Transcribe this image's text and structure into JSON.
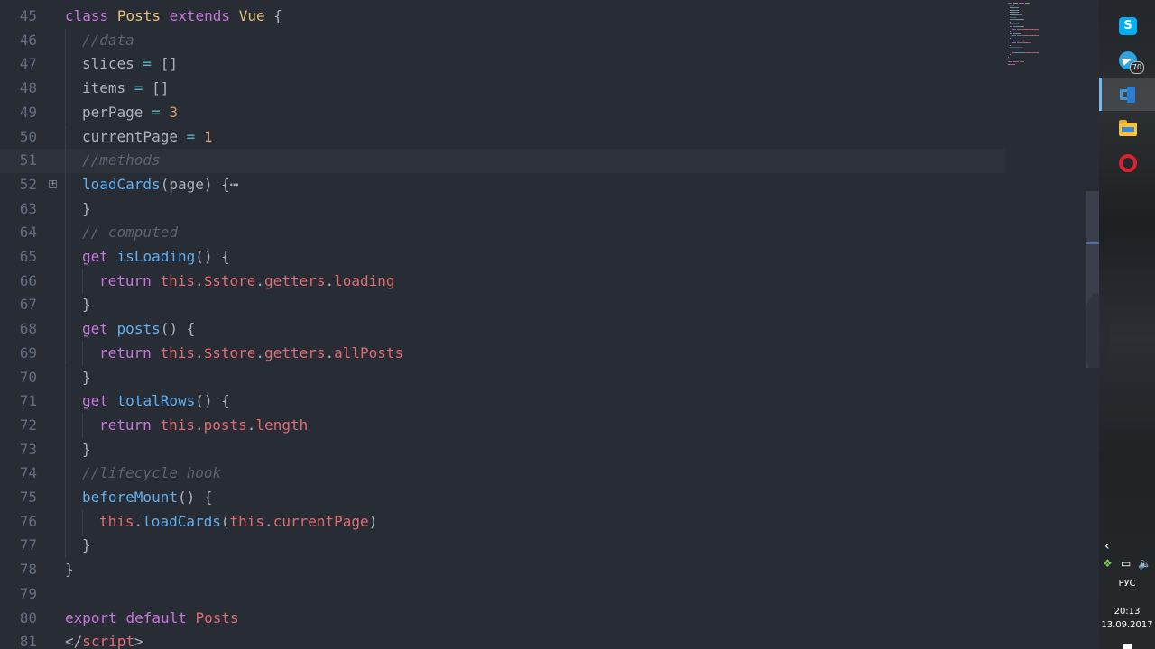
{
  "editor": {
    "current_line": "51",
    "lines": [
      {
        "num": "45",
        "indent": 0,
        "tokens": [
          {
            "t": "keyword",
            "v": "class"
          },
          {
            "t": "ident",
            "v": " "
          },
          {
            "t": "class",
            "v": "Posts"
          },
          {
            "t": "ident",
            "v": " "
          },
          {
            "t": "keyword",
            "v": "extends"
          },
          {
            "t": "ident",
            "v": " "
          },
          {
            "t": "class",
            "v": "Vue"
          },
          {
            "t": "punct",
            "v": " {"
          }
        ]
      },
      {
        "num": "46",
        "indent": 1,
        "tokens": [
          {
            "t": "comment",
            "v": "//data"
          }
        ]
      },
      {
        "num": "47",
        "indent": 1,
        "tokens": [
          {
            "t": "ident",
            "v": "slices"
          },
          {
            "t": "op",
            "v": " = "
          },
          {
            "t": "punct",
            "v": "[]"
          }
        ]
      },
      {
        "num": "48",
        "indent": 1,
        "tokens": [
          {
            "t": "ident",
            "v": "items"
          },
          {
            "t": "op",
            "v": " = "
          },
          {
            "t": "punct",
            "v": "[]"
          }
        ]
      },
      {
        "num": "49",
        "indent": 1,
        "tokens": [
          {
            "t": "ident",
            "v": "perPage"
          },
          {
            "t": "op",
            "v": " = "
          },
          {
            "t": "number",
            "v": "3"
          }
        ]
      },
      {
        "num": "50",
        "indent": 1,
        "tokens": [
          {
            "t": "ident",
            "v": "currentPage"
          },
          {
            "t": "op",
            "v": " = "
          },
          {
            "t": "number",
            "v": "1"
          }
        ]
      },
      {
        "num": "51",
        "indent": 1,
        "tokens": [
          {
            "t": "comment",
            "v": "//methods"
          }
        ]
      },
      {
        "num": "52",
        "indent": 1,
        "folded": true,
        "tokens": [
          {
            "t": "func",
            "v": "loadCards"
          },
          {
            "t": "punct",
            "v": "(page) {"
          },
          {
            "t": "ellipsis",
            "v": "⋯"
          }
        ]
      },
      {
        "num": "63",
        "indent": 1,
        "tokens": [
          {
            "t": "punct",
            "v": "}"
          }
        ]
      },
      {
        "num": "64",
        "indent": 1,
        "tokens": [
          {
            "t": "comment",
            "v": "// computed"
          }
        ]
      },
      {
        "num": "65",
        "indent": 1,
        "tokens": [
          {
            "t": "keyword",
            "v": "get"
          },
          {
            "t": "ident",
            "v": " "
          },
          {
            "t": "func",
            "v": "isLoading"
          },
          {
            "t": "punct",
            "v": "() {"
          }
        ]
      },
      {
        "num": "66",
        "indent": 2,
        "tokens": [
          {
            "t": "keyword",
            "v": "return"
          },
          {
            "t": "ident",
            "v": " "
          },
          {
            "t": "this",
            "v": "this"
          },
          {
            "t": "punct",
            "v": "."
          },
          {
            "t": "prop",
            "v": "$store"
          },
          {
            "t": "punct",
            "v": "."
          },
          {
            "t": "prop",
            "v": "getters"
          },
          {
            "t": "punct",
            "v": "."
          },
          {
            "t": "prop",
            "v": "loading"
          }
        ]
      },
      {
        "num": "67",
        "indent": 1,
        "tokens": [
          {
            "t": "punct",
            "v": "}"
          }
        ]
      },
      {
        "num": "68",
        "indent": 1,
        "tokens": [
          {
            "t": "keyword",
            "v": "get"
          },
          {
            "t": "ident",
            "v": " "
          },
          {
            "t": "func",
            "v": "posts"
          },
          {
            "t": "punct",
            "v": "() {"
          }
        ]
      },
      {
        "num": "69",
        "indent": 2,
        "tokens": [
          {
            "t": "keyword",
            "v": "return"
          },
          {
            "t": "ident",
            "v": " "
          },
          {
            "t": "this",
            "v": "this"
          },
          {
            "t": "punct",
            "v": "."
          },
          {
            "t": "prop",
            "v": "$store"
          },
          {
            "t": "punct",
            "v": "."
          },
          {
            "t": "prop",
            "v": "getters"
          },
          {
            "t": "punct",
            "v": "."
          },
          {
            "t": "prop",
            "v": "allPosts"
          }
        ]
      },
      {
        "num": "70",
        "indent": 1,
        "tokens": [
          {
            "t": "punct",
            "v": "}"
          }
        ]
      },
      {
        "num": "71",
        "indent": 1,
        "tokens": [
          {
            "t": "keyword",
            "v": "get"
          },
          {
            "t": "ident",
            "v": " "
          },
          {
            "t": "func",
            "v": "totalRows"
          },
          {
            "t": "punct",
            "v": "() {"
          }
        ]
      },
      {
        "num": "72",
        "indent": 2,
        "tokens": [
          {
            "t": "keyword",
            "v": "return"
          },
          {
            "t": "ident",
            "v": " "
          },
          {
            "t": "this",
            "v": "this"
          },
          {
            "t": "punct",
            "v": "."
          },
          {
            "t": "prop",
            "v": "posts"
          },
          {
            "t": "punct",
            "v": "."
          },
          {
            "t": "prop",
            "v": "length"
          }
        ]
      },
      {
        "num": "73",
        "indent": 1,
        "tokens": [
          {
            "t": "punct",
            "v": "}"
          }
        ]
      },
      {
        "num": "74",
        "indent": 1,
        "tokens": [
          {
            "t": "comment",
            "v": "//lifecycle hook"
          }
        ]
      },
      {
        "num": "75",
        "indent": 1,
        "tokens": [
          {
            "t": "func",
            "v": "beforeMount"
          },
          {
            "t": "punct",
            "v": "() {"
          }
        ]
      },
      {
        "num": "76",
        "indent": 2,
        "tokens": [
          {
            "t": "this",
            "v": "this"
          },
          {
            "t": "punct",
            "v": "."
          },
          {
            "t": "func",
            "v": "loadCards"
          },
          {
            "t": "punct",
            "v": "("
          },
          {
            "t": "this",
            "v": "this"
          },
          {
            "t": "punct",
            "v": "."
          },
          {
            "t": "prop",
            "v": "currentPage"
          },
          {
            "t": "punct",
            "v": ")"
          }
        ]
      },
      {
        "num": "77",
        "indent": 1,
        "tokens": [
          {
            "t": "punct",
            "v": "}"
          }
        ]
      },
      {
        "num": "78",
        "indent": 0,
        "tokens": [
          {
            "t": "punct",
            "v": "}"
          }
        ]
      },
      {
        "num": "79",
        "indent": 0,
        "tokens": []
      },
      {
        "num": "80",
        "indent": 0,
        "tokens": [
          {
            "t": "keyword",
            "v": "export"
          },
          {
            "t": "ident",
            "v": " "
          },
          {
            "t": "keyword",
            "v": "default"
          },
          {
            "t": "ident",
            "v": " "
          },
          {
            "t": "this",
            "v": "Posts"
          }
        ]
      },
      {
        "num": "81",
        "indent": 0,
        "tokens": [
          {
            "t": "punct",
            "v": "</"
          },
          {
            "t": "this",
            "v": "script"
          },
          {
            "t": "punct",
            "v": ">"
          }
        ]
      }
    ]
  },
  "colors": {
    "editor_bg": "#282c34",
    "keyword": "#c678dd",
    "class": "#e5c07b",
    "function": "#61afef",
    "comment": "#5c6370",
    "number": "#d19a66",
    "variable": "#e06c75",
    "operator": "#56b6c2",
    "text": "#abb2bf",
    "line_number": "#636d83",
    "taskbar_accent": "#76b9ed"
  },
  "taskbar": {
    "apps": [
      {
        "name": "skype",
        "icon": "skype-icon",
        "glyph": "S",
        "active": false
      },
      {
        "name": "telegram",
        "icon": "telegram-icon",
        "badge": "70",
        "active": false
      },
      {
        "name": "vscode",
        "icon": "vscode-icon",
        "active": true
      },
      {
        "name": "file-explorer",
        "icon": "folder-icon",
        "active": false
      },
      {
        "name": "opera",
        "icon": "opera-icon",
        "active": false
      }
    ],
    "tray": {
      "chevron": "‹",
      "dropbox_glyph": "❖",
      "network_glyph": "▭",
      "volume_glyph": "🔈",
      "language": "РУС",
      "time": "20:13",
      "date": "13.09.2017"
    }
  }
}
